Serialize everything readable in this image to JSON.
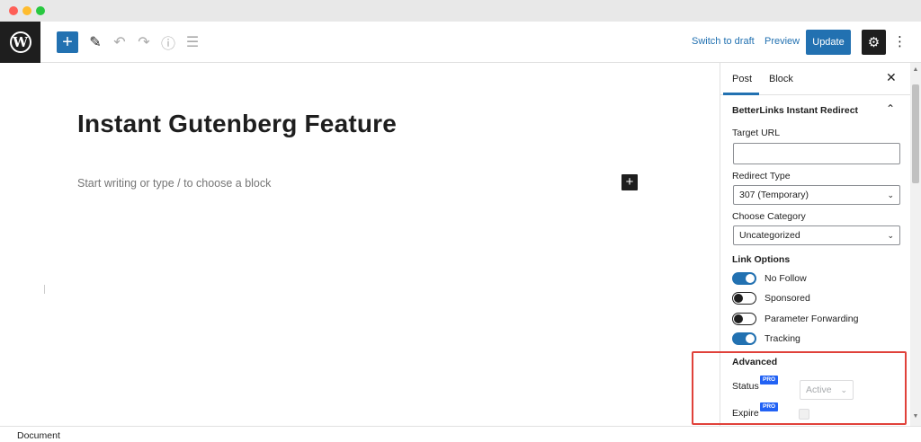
{
  "toolbar": {
    "logo_glyph": "W",
    "add_glyph": "+",
    "tools_glyph": "✎",
    "undo_glyph": "↶",
    "redo_glyph": "↷",
    "info_glyph": "ⓘ",
    "list_glyph": "☰",
    "switch_to_draft": "Switch to draft",
    "preview": "Preview",
    "update": "Update",
    "settings_glyph": "⚙",
    "more_glyph": "⋮"
  },
  "editor": {
    "title": "Instant Gutenberg Feature",
    "placeholder": "Start writing or type / to choose a block",
    "inline_add_glyph": "+"
  },
  "sidebar": {
    "tabs": [
      {
        "label": "Post",
        "active": true
      },
      {
        "label": "Block",
        "active": false
      }
    ],
    "close_glyph": "✕",
    "panel_title": "BetterLinks Instant Redirect",
    "panel_chevron": "⌃",
    "target_url_label": "Target URL",
    "target_url_value": "",
    "redirect_type_label": "Redirect Type",
    "redirect_type_value": "307 (Temporary)",
    "category_label": "Choose Category",
    "category_value": "Uncategorized",
    "link_options_title": "Link Options",
    "toggles": [
      {
        "label": "No Follow",
        "on": true
      },
      {
        "label": "Sponsored",
        "on": false
      },
      {
        "label": "Parameter Forwarding",
        "on": false
      },
      {
        "label": "Tracking",
        "on": true
      }
    ],
    "advanced_title": "Advanced",
    "status_label": "Status",
    "status_badge": "PRO",
    "status_value": "Active",
    "expire_label": "Expire",
    "expire_badge": "PRO",
    "select_chevron": "⌄"
  },
  "scrollbar": {
    "up_glyph": "▲",
    "down_glyph": "▼"
  },
  "footer": {
    "breadcrumb": "Document"
  },
  "colors": {
    "accent": "#2271b1",
    "highlight": "#e0413a",
    "pro_badge": "#2262f4"
  }
}
